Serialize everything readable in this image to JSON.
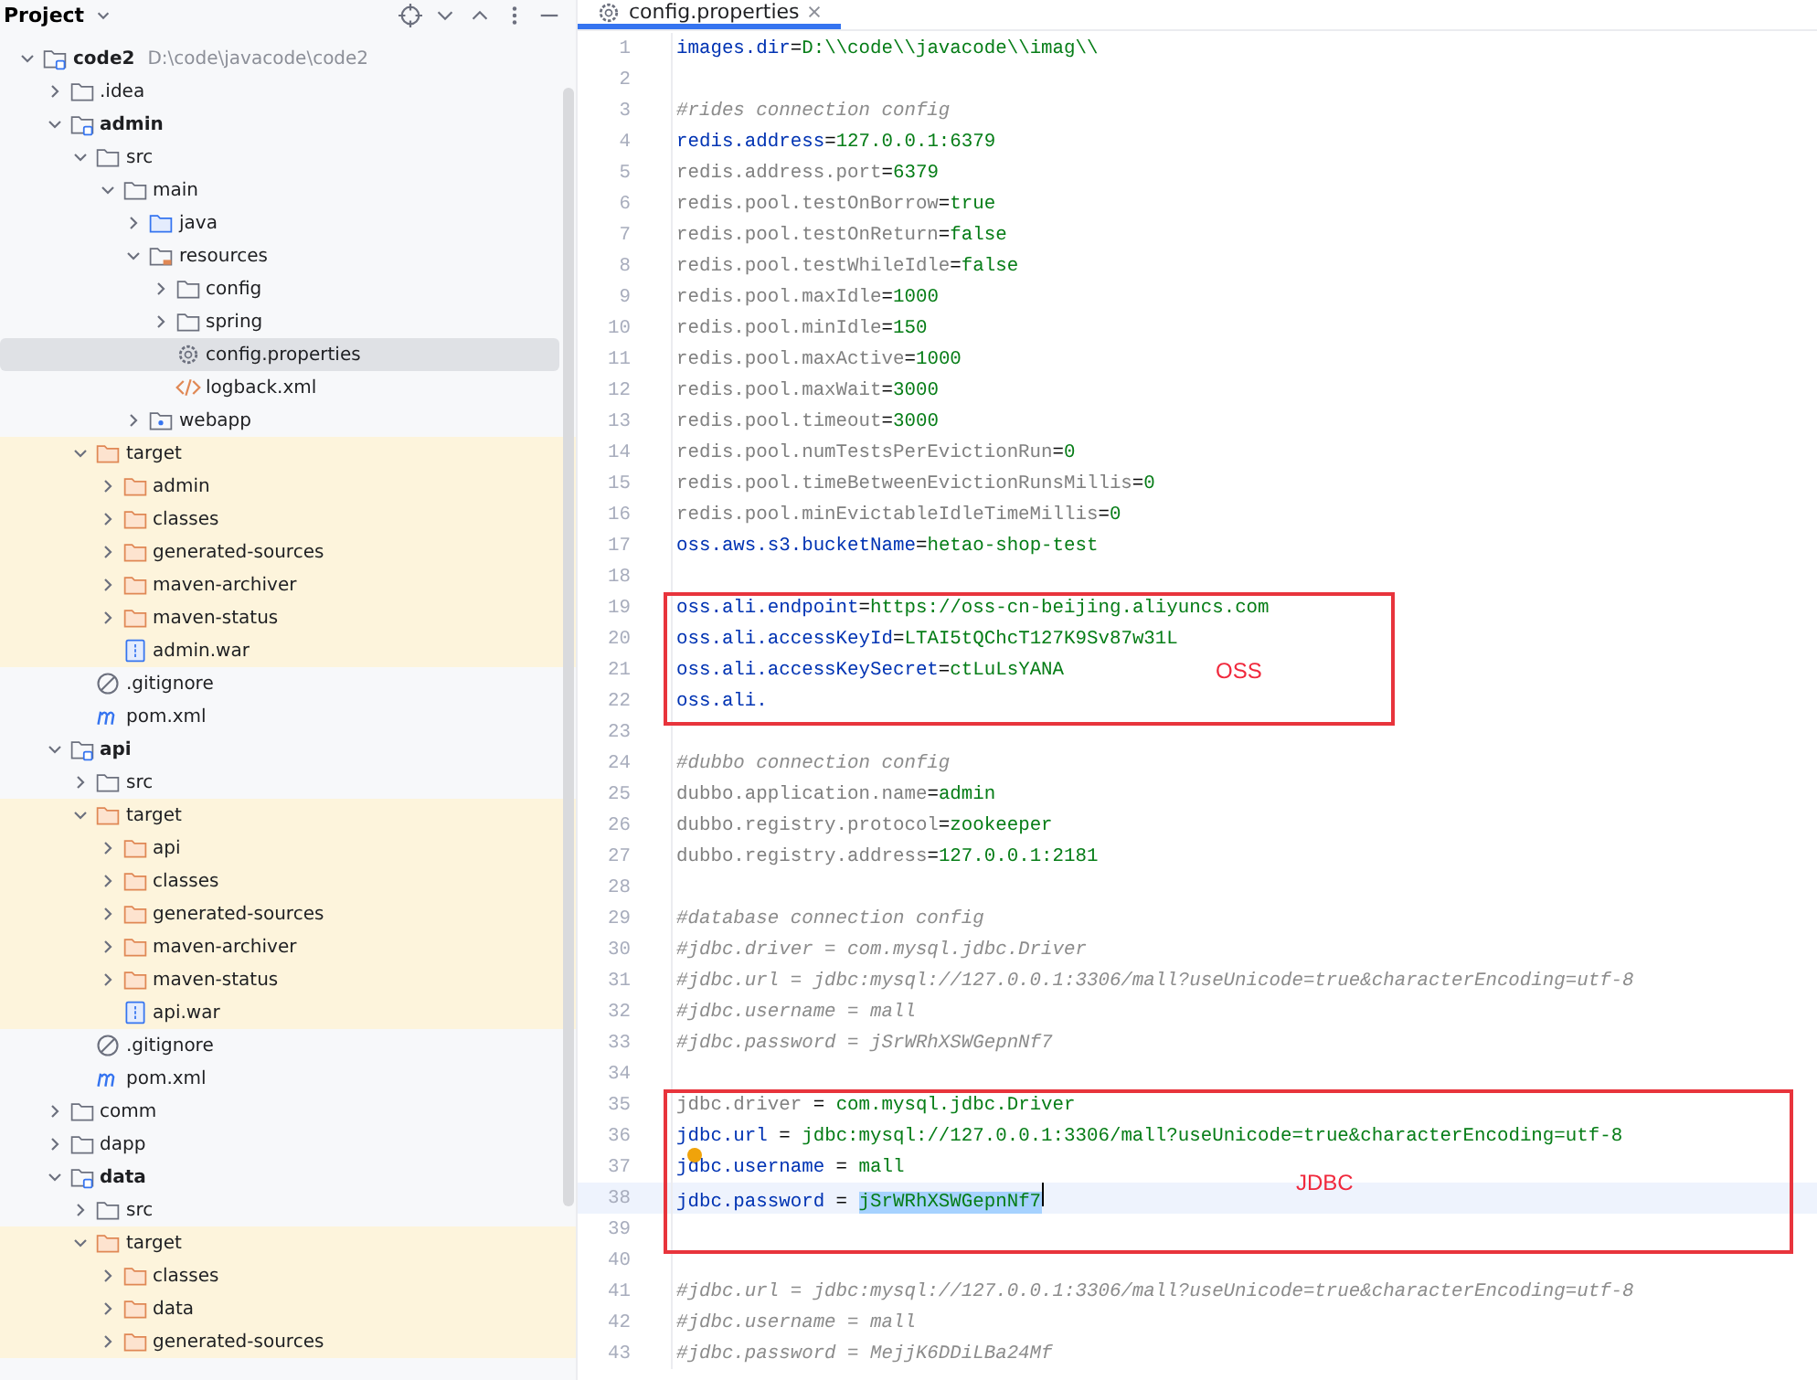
{
  "project_panel": {
    "title": "Project",
    "tree": [
      {
        "name": "code2",
        "path": "D:\\code\\javacode\\code2",
        "kind": "module",
        "expanded": true,
        "selected": false,
        "children": [
          {
            "name": ".idea",
            "kind": "folder",
            "expanded": false,
            "selected": false
          },
          {
            "name": "admin",
            "kind": "module",
            "expanded": true,
            "selected": false,
            "children": [
              {
                "name": "src",
                "kind": "folder",
                "expanded": true,
                "selected": false,
                "children": [
                  {
                    "name": "main",
                    "kind": "folder",
                    "expanded": true,
                    "selected": false,
                    "children": [
                      {
                        "name": "java",
                        "kind": "source",
                        "expanded": false,
                        "selected": false
                      },
                      {
                        "name": "resources",
                        "kind": "resources",
                        "expanded": true,
                        "selected": false,
                        "children": [
                          {
                            "name": "config",
                            "kind": "folder",
                            "expanded": false,
                            "selected": false
                          },
                          {
                            "name": "spring",
                            "kind": "folder",
                            "expanded": false,
                            "selected": false
                          },
                          {
                            "name": "config.properties",
                            "kind": "properties",
                            "selected": true
                          },
                          {
                            "name": "logback.xml",
                            "kind": "xml",
                            "selected": false
                          }
                        ]
                      },
                      {
                        "name": "webapp",
                        "kind": "webapp",
                        "expanded": false,
                        "selected": false
                      }
                    ]
                  }
                ]
              },
              {
                "name": "target",
                "kind": "excluded",
                "expanded": true,
                "selected": false,
                "children": [
                  {
                    "name": "admin",
                    "kind": "excluded",
                    "expanded": false,
                    "selected": false
                  },
                  {
                    "name": "classes",
                    "kind": "excluded",
                    "expanded": false,
                    "selected": false
                  },
                  {
                    "name": "generated-sources",
                    "kind": "excluded",
                    "expanded": false,
                    "selected": false
                  },
                  {
                    "name": "maven-archiver",
                    "kind": "excluded",
                    "expanded": false,
                    "selected": false
                  },
                  {
                    "name": "maven-status",
                    "kind": "excluded",
                    "expanded": false,
                    "selected": false
                  },
                  {
                    "name": "admin.war",
                    "kind": "war",
                    "selected": false
                  }
                ]
              },
              {
                "name": ".gitignore",
                "kind": "gitignore",
                "selected": false
              },
              {
                "name": "pom.xml",
                "kind": "maven",
                "selected": false
              }
            ]
          },
          {
            "name": "api",
            "kind": "module",
            "expanded": true,
            "selected": false,
            "children": [
              {
                "name": "src",
                "kind": "folder",
                "expanded": false,
                "selected": false
              },
              {
                "name": "target",
                "kind": "excluded",
                "expanded": true,
                "selected": false,
                "children": [
                  {
                    "name": "api",
                    "kind": "excluded",
                    "expanded": false,
                    "selected": false
                  },
                  {
                    "name": "classes",
                    "kind": "excluded",
                    "expanded": false,
                    "selected": false
                  },
                  {
                    "name": "generated-sources",
                    "kind": "excluded",
                    "expanded": false,
                    "selected": false
                  },
                  {
                    "name": "maven-archiver",
                    "kind": "excluded",
                    "expanded": false,
                    "selected": false
                  },
                  {
                    "name": "maven-status",
                    "kind": "excluded",
                    "expanded": false,
                    "selected": false
                  },
                  {
                    "name": "api.war",
                    "kind": "war",
                    "selected": false
                  }
                ]
              },
              {
                "name": ".gitignore",
                "kind": "gitignore",
                "selected": false
              },
              {
                "name": "pom.xml",
                "kind": "maven",
                "selected": false
              }
            ]
          },
          {
            "name": "comm",
            "kind": "folder",
            "expanded": false,
            "selected": false
          },
          {
            "name": "dapp",
            "kind": "folder",
            "expanded": false,
            "selected": false
          },
          {
            "name": "data",
            "kind": "module",
            "expanded": true,
            "selected": false,
            "children": [
              {
                "name": "src",
                "kind": "folder",
                "expanded": false,
                "selected": false
              },
              {
                "name": "target",
                "kind": "excluded",
                "expanded": true,
                "selected": false,
                "children": [
                  {
                    "name": "classes",
                    "kind": "excluded",
                    "expanded": false,
                    "selected": false
                  },
                  {
                    "name": "data",
                    "kind": "excluded",
                    "expanded": false,
                    "selected": false
                  },
                  {
                    "name": "generated-sources",
                    "kind": "excluded",
                    "expanded": false,
                    "selected": false
                  }
                ]
              }
            ]
          }
        ]
      }
    ]
  },
  "editor": {
    "tabs": [
      {
        "label": "config.properties",
        "selected": true
      }
    ],
    "lines": [
      {
        "n": "1",
        "kind": "prop",
        "key": "images.dir",
        "sep": "=",
        "value": "D:\\\\code\\\\javacode\\\\imag\\\\",
        "used": true
      },
      {
        "n": "2",
        "kind": "blank"
      },
      {
        "n": "3",
        "kind": "comment",
        "text": "#rides connection config"
      },
      {
        "n": "4",
        "kind": "prop",
        "key": "redis.address",
        "sep": "=",
        "value": "127.0.0.1:6379",
        "used": true
      },
      {
        "n": "5",
        "kind": "prop",
        "key": "redis.address.port",
        "sep": "=",
        "value": "6379",
        "used": false
      },
      {
        "n": "6",
        "kind": "prop",
        "key": "redis.pool.testOnBorrow",
        "sep": "=",
        "value": "true",
        "used": false
      },
      {
        "n": "7",
        "kind": "prop",
        "key": "redis.pool.testOnReturn",
        "sep": "=",
        "value": "false",
        "used": false
      },
      {
        "n": "8",
        "kind": "prop",
        "key": "redis.pool.testWhileIdle",
        "sep": "=",
        "value": "false",
        "used": false
      },
      {
        "n": "9",
        "kind": "prop",
        "key": "redis.pool.maxIdle",
        "sep": "=",
        "value": "1000",
        "used": false
      },
      {
        "n": "10",
        "kind": "prop",
        "key": "redis.pool.minIdle",
        "sep": "=",
        "value": "150",
        "used": false
      },
      {
        "n": "11",
        "kind": "prop",
        "key": "redis.pool.maxActive",
        "sep": "=",
        "value": "1000",
        "used": false
      },
      {
        "n": "12",
        "kind": "prop",
        "key": "redis.pool.maxWait",
        "sep": "=",
        "value": "3000",
        "used": false
      },
      {
        "n": "13",
        "kind": "prop",
        "key": "redis.pool.timeout",
        "sep": "=",
        "value": "3000",
        "used": false
      },
      {
        "n": "14",
        "kind": "prop",
        "key": "redis.pool.numTestsPerEvictionRun",
        "sep": "=",
        "value": "0",
        "used": false
      },
      {
        "n": "15",
        "kind": "prop",
        "key": "redis.pool.timeBetweenEvictionRunsMillis",
        "sep": "=",
        "value": "0",
        "used": false
      },
      {
        "n": "16",
        "kind": "prop",
        "key": "redis.pool.minEvictableIdleTimeMillis",
        "sep": "=",
        "value": "0",
        "used": false
      },
      {
        "n": "17",
        "kind": "prop",
        "key": "oss.aws.s3.bucketName",
        "sep": "=",
        "value": "hetao-shop-test",
        "used": true
      },
      {
        "n": "18",
        "kind": "blank"
      },
      {
        "n": "19",
        "kind": "prop",
        "key": "oss.ali.endpoint",
        "sep": "=",
        "value": "https://oss-cn-beijing.aliyuncs.com",
        "used": true
      },
      {
        "n": "20",
        "kind": "prop",
        "key": "oss.ali.accessKeyId",
        "sep": "=",
        "value": "LTAI5tQChcT127K9Sv87w31L",
        "used": true
      },
      {
        "n": "21",
        "kind": "prop",
        "key": "oss.ali.accessKeySecret",
        "sep": "=",
        "value": "ctLuLsYANA",
        "used": true
      },
      {
        "n": "22",
        "kind": "prop",
        "key": "oss.ali.",
        "used": true
      },
      {
        "n": "23",
        "kind": "blank"
      },
      {
        "n": "24",
        "kind": "comment",
        "text": "#dubbo connection config"
      },
      {
        "n": "25",
        "kind": "prop",
        "key": "dubbo.application.name",
        "sep": "=",
        "value": "admin",
        "used": false
      },
      {
        "n": "26",
        "kind": "prop",
        "key": "dubbo.registry.protocol",
        "sep": "=",
        "value": "zookeeper",
        "used": false
      },
      {
        "n": "27",
        "kind": "prop",
        "key": "dubbo.registry.address",
        "sep": "=",
        "value": "127.0.0.1:2181",
        "used": false
      },
      {
        "n": "28",
        "kind": "blank"
      },
      {
        "n": "29",
        "kind": "comment",
        "text": "#database connection config"
      },
      {
        "n": "30",
        "kind": "comment",
        "text": "#jdbc.driver = com.mysql.jdbc.Driver"
      },
      {
        "n": "31",
        "kind": "comment",
        "text": "#jdbc.url = jdbc:mysql://127.0.0.1:3306/mall?useUnicode=true&characterEncoding=utf-8"
      },
      {
        "n": "32",
        "kind": "comment",
        "text": "#jdbc.username = mall"
      },
      {
        "n": "33",
        "kind": "comment",
        "text": "#jdbc.password = jSrWRhXSWGepnNf7"
      },
      {
        "n": "34",
        "kind": "blank"
      },
      {
        "n": "35",
        "kind": "prop",
        "key": "jdbc.driver",
        "sep": " = ",
        "value": "com.mysql.jdbc.Driver",
        "used": false
      },
      {
        "n": "36",
        "kind": "prop",
        "key": "jdbc.url",
        "sep": " = ",
        "value": "jdbc:mysql://127.0.0.1:3306/mall?useUnicode=true&characterEncoding=utf-8",
        "used": true
      },
      {
        "n": "37",
        "kind": "prop",
        "key": "jdbc.username",
        "sep": " = ",
        "value": "mall",
        "used": true,
        "marker": true
      },
      {
        "n": "38",
        "kind": "prop",
        "key": "jdbc.password",
        "sep": " = ",
        "value": "jSrWRhXSWGepnNf7",
        "used": true,
        "current": true,
        "value_selected": true
      },
      {
        "n": "39",
        "kind": "blank"
      },
      {
        "n": "40",
        "kind": "blank"
      },
      {
        "n": "41",
        "kind": "comment",
        "text": "#jdbc.url = jdbc:mysql://127.0.0.1:3306/mall?useUnicode=true&characterEncoding=utf-8"
      },
      {
        "n": "42",
        "kind": "comment",
        "text": "#jdbc.username = mall"
      },
      {
        "n": "43",
        "kind": "comment",
        "text": "#jdbc.password = MejjK6DDiLBa24Mf"
      }
    ],
    "annotations": [
      {
        "label": "OSS"
      },
      {
        "label": "JDBC"
      }
    ]
  }
}
